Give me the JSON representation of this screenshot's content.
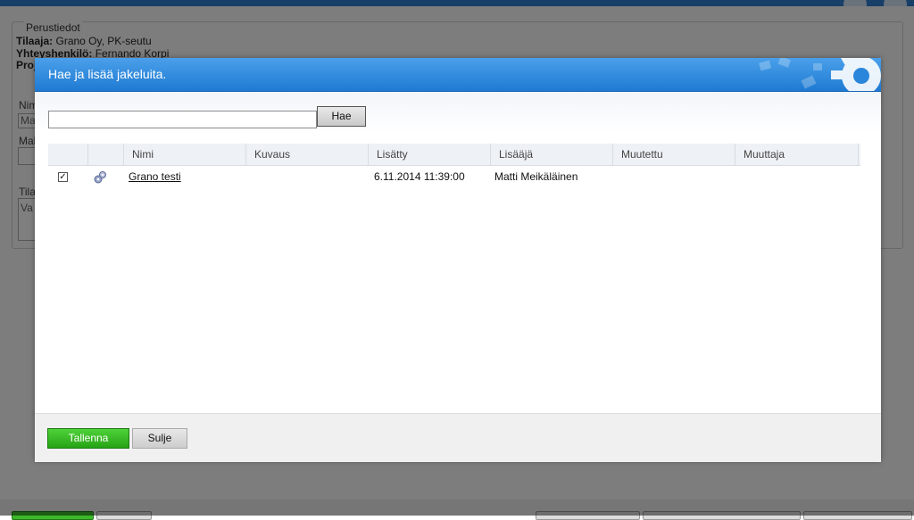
{
  "background": {
    "section_title": "Perustiedot",
    "tilaaja_label": "Tilaaja:",
    "tilaaja_value": "Grano Oy, PK-seutu",
    "yhteyshenkilo_label": "Yhteyshenkilö:",
    "yhteyshenkilo_value": "Fernando Korpi",
    "projekti_label": "Proj",
    "field1_label": "Nim",
    "field1_value": "Ma",
    "field2_label": "Mal",
    "field3_label": "Tila",
    "field3_value": "Va"
  },
  "dialog": {
    "title": "Hae ja lisää jakeluita.",
    "search": {
      "value": "",
      "placeholder": "",
      "button_label": "Hae"
    },
    "columns": [
      "",
      "",
      "Nimi",
      "Kuvaus",
      "Lisätty",
      "Lisääjä",
      "Muutettu",
      "Muuttaja"
    ],
    "rows": [
      {
        "checked": true,
        "icon": "distribution-icon",
        "nimi": "Grano testi",
        "kuvaus": "",
        "lisatty": "6.11.2014 11:39:00",
        "lisaaja": "Matti Meikäläinen",
        "muutettu": "",
        "muuttaja": ""
      }
    ],
    "footer": {
      "save_label": "Tallenna",
      "close_label": "Sulje"
    }
  },
  "colors": {
    "header_blue": "#1f7ad2",
    "save_green": "#26a314",
    "overlay": "rgba(0,0,0,0.5)"
  }
}
